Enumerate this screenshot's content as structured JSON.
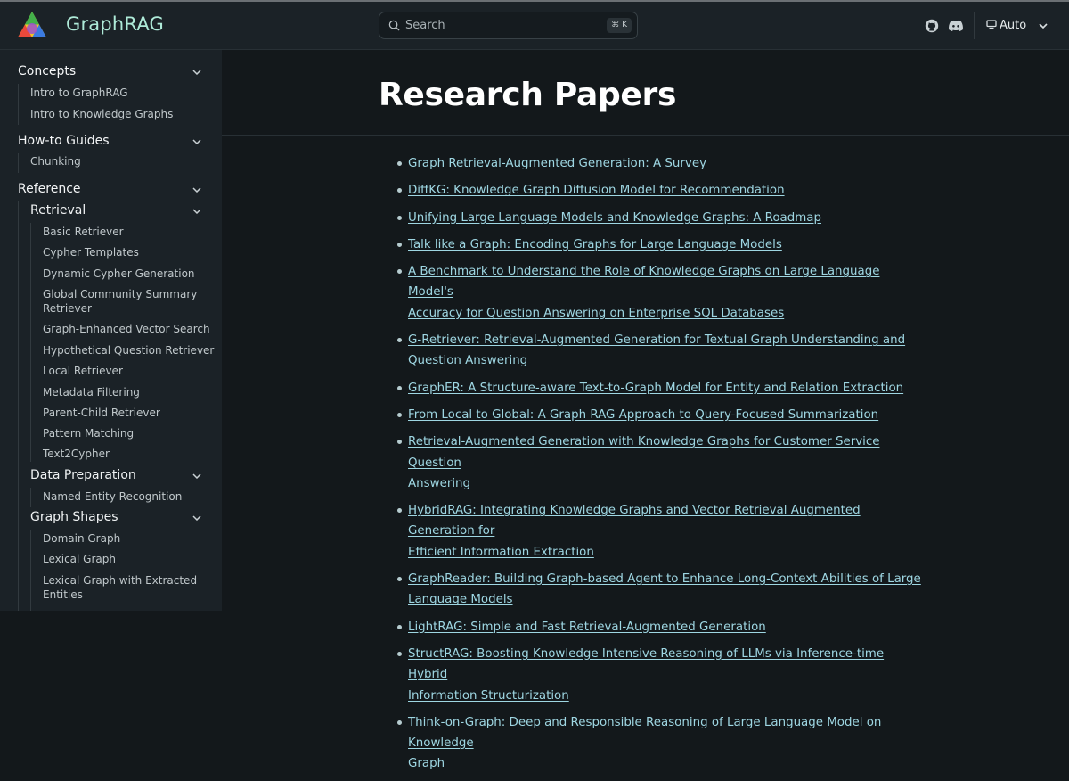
{
  "header": {
    "brand": "GraphRAG",
    "search_placeholder": "Search",
    "search_shortcut": "⌘ K",
    "theme_label": "Auto"
  },
  "sidebar": {
    "concepts": {
      "title": "Concepts",
      "items": [
        "Intro to GraphRAG",
        "Intro to Knowledge Graphs"
      ]
    },
    "howto": {
      "title": "How-to Guides",
      "items": [
        "Chunking"
      ]
    },
    "reference": {
      "title": "Reference",
      "retrieval": {
        "title": "Retrieval",
        "items": [
          "Basic Retriever",
          "Cypher Templates",
          "Dynamic Cypher Generation",
          "Global Community Summary",
          "Retriever",
          "Graph-Enhanced Vector Search",
          "Hypothetical Question Retriever",
          "Local Retriever",
          "Metadata Filtering",
          "Parent-Child Retriever",
          "Pattern Matching",
          "Text2Cypher"
        ]
      },
      "data_prep": {
        "title": "Data Preparation",
        "items": [
          "Named Entity Recognition"
        ]
      },
      "graph_shapes": {
        "title": "Graph Shapes",
        "items": [
          "Domain Graph",
          "Lexical Graph",
          "Lexical Graph with Extracted",
          "Entities"
        ]
      }
    }
  },
  "main": {
    "title": "Research Papers",
    "papers": [
      [
        "Graph Retrieval-Augmented Generation: A Survey"
      ],
      [
        "DiffKG: Knowledge Graph Diffusion Model for Recommendation"
      ],
      [
        "Unifying Large Language Models and Knowledge Graphs: A Roadmap"
      ],
      [
        "Talk like a Graph: Encoding Graphs for Large Language Models"
      ],
      [
        "A Benchmark to Understand the Role of Knowledge Graphs on Large Language Model's",
        "Accuracy for Question Answering on Enterprise SQL Databases"
      ],
      [
        "G-Retriever: Retrieval-Augmented Generation for Textual Graph Understanding and",
        "Question Answering"
      ],
      [
        "GraphER: A Structure-aware Text-to-Graph Model for Entity and Relation Extraction"
      ],
      [
        "From Local to Global: A Graph RAG Approach to Query-Focused Summarization"
      ],
      [
        "Retrieval-Augmented Generation with Knowledge Graphs for Customer Service Question",
        "Answering"
      ],
      [
        "HybridRAG: Integrating Knowledge Graphs and Vector Retrieval Augmented Generation for",
        "Efficient Information Extraction"
      ],
      [
        "GraphReader: Building Graph-based Agent to Enhance Long-Context Abilities of Large",
        "Language Models"
      ],
      [
        "LightRAG: Simple and Fast Retrieval-Augmented Generation"
      ],
      [
        "StructRAG: Boosting Knowledge Intensive Reasoning of LLMs via Inference-time Hybrid",
        "Information Structurization"
      ],
      [
        "Think-on-Graph: Deep and Responsible Reasoning of Large Language Model on Knowledge",
        "Graph"
      ]
    ]
  },
  "colors": {
    "link": "#9ed6e2",
    "brand": "#aeead8",
    "sidebar_bg": "#1b2227",
    "main_bg": "#13181b"
  }
}
